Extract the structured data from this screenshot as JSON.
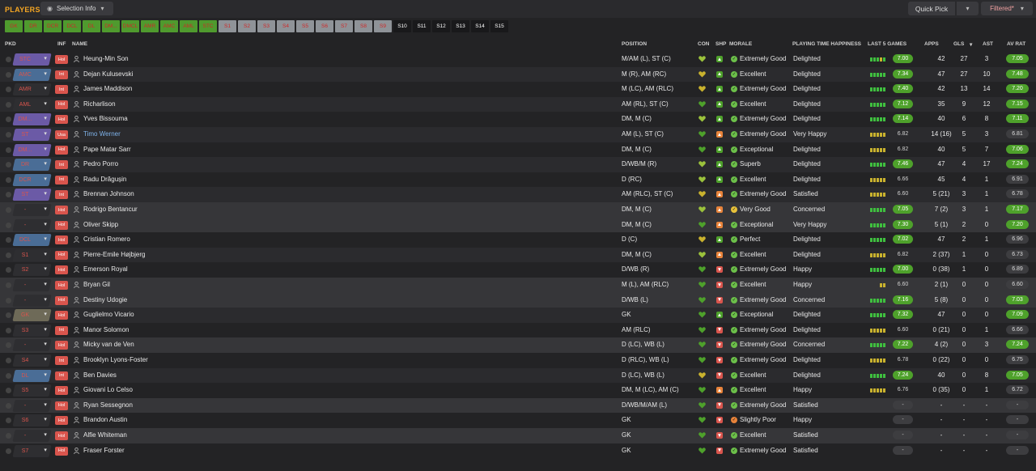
{
  "topbar": {
    "title": "PLAYERS",
    "selection_info": "Selection Info",
    "quick_pick": "Quick Pick",
    "filtered": "Filtered*"
  },
  "position_filters": [
    {
      "label": "GK",
      "state": "g"
    },
    {
      "label": "DR",
      "state": "g"
    },
    {
      "label": "DCR",
      "state": "g"
    },
    {
      "label": "DCL",
      "state": "g"
    },
    {
      "label": "DL",
      "state": "g"
    },
    {
      "label": "DM...",
      "state": "g"
    },
    {
      "label": "DMCL",
      "state": "g"
    },
    {
      "label": "AMR",
      "state": "g"
    },
    {
      "label": "AMC",
      "state": "g"
    },
    {
      "label": "AML",
      "state": "g"
    },
    {
      "label": "STC",
      "state": "g"
    },
    {
      "label": "S1",
      "state": "s"
    },
    {
      "label": "S2",
      "state": "s"
    },
    {
      "label": "S3",
      "state": "s"
    },
    {
      "label": "S4",
      "state": "s"
    },
    {
      "label": "S5",
      "state": "s"
    },
    {
      "label": "S6",
      "state": "s"
    },
    {
      "label": "S7",
      "state": "s"
    },
    {
      "label": "S8",
      "state": "s"
    },
    {
      "label": "S9",
      "state": "s"
    },
    {
      "label": "S10",
      "state": "d"
    },
    {
      "label": "S11",
      "state": "d"
    },
    {
      "label": "S12",
      "state": "d"
    },
    {
      "label": "S13",
      "state": "d"
    },
    {
      "label": "S14",
      "state": "d"
    },
    {
      "label": "S15",
      "state": "d"
    }
  ],
  "columns": {
    "pkd": "PKD",
    "inf": "INF",
    "name": "NAME",
    "position": "POSITION",
    "con": "CON",
    "shp": "SHP",
    "morale": "MORALE",
    "pth": "PLAYING TIME HAPPINESS",
    "last5": "LAST 5 GAMES",
    "apps": "APPS",
    "gls": "GLS",
    "ast": "AST",
    "avrat": "AV RAT"
  },
  "colors": {
    "green": "#4ea12b",
    "yellow_green": "#9bc23c",
    "yellow": "#c9b22e",
    "olive": "#b9a93c",
    "red": "#d9554d",
    "orange": "#e8833a",
    "purple": "#6b5aa6",
    "blue": "#4a6d96",
    "tan": "#6e6a58",
    "gray": "#8c8c8c"
  },
  "players": [
    {
      "pill": "STC",
      "pc": "#6b5aa6",
      "inf": "Hol",
      "name": "Heung-Min Son",
      "pos": "M/AM (L), ST (C)",
      "con": "#9bc23c",
      "shp": "up",
      "morale": "Extremely Good",
      "mc": "#6cc04a",
      "pth": "Delighted",
      "bars": [
        "g",
        "g",
        "g",
        "y",
        "g"
      ],
      "rating": "7.00",
      "rc": "#4ea12b",
      "apps": "42",
      "gls": "27",
      "ast": "3",
      "avr": "7.05",
      "avc": "#4ea12b"
    },
    {
      "pill": "AMC",
      "pc": "#4a6d96",
      "inf": "Int",
      "name": "Dejan Kulusevski",
      "pos": "M (R), AM (RC)",
      "con": "#c9b22e",
      "shp": "up",
      "morale": "Excellent",
      "mc": "#6cc04a",
      "pth": "Delighted",
      "bars": [
        "g",
        "g",
        "g",
        "g",
        "g"
      ],
      "rating": "7.34",
      "rc": "#4ea12b",
      "apps": "47",
      "gls": "27",
      "ast": "10",
      "avr": "7.48",
      "avc": "#4ea12b"
    },
    {
      "pill": "AMR",
      "pc": "#2e2e31",
      "inf": "Int",
      "name": "James Maddison",
      "pos": "M (LC), AM (RLC)",
      "con": "#c9b22e",
      "shp": "up",
      "morale": "Extremely Good",
      "mc": "#6cc04a",
      "pth": "Delighted",
      "bars": [
        "g",
        "g",
        "g",
        "g",
        "g"
      ],
      "rating": "7.40",
      "rc": "#4ea12b",
      "apps": "42",
      "gls": "13",
      "ast": "14",
      "avr": "7.20",
      "avc": "#4ea12b"
    },
    {
      "pill": "AML",
      "pc": "#2e2e31",
      "inf": "Hol",
      "name": "Richarlison",
      "pos": "AM (RL), ST (C)",
      "con": "#4ea12b",
      "shp": "up",
      "morale": "Excellent",
      "mc": "#6cc04a",
      "pth": "Delighted",
      "bars": [
        "g",
        "g",
        "g",
        "g",
        "g"
      ],
      "rating": "7.12",
      "rc": "#4ea12b",
      "apps": "35",
      "gls": "9",
      "ast": "12",
      "avr": "7.15",
      "avc": "#4ea12b"
    },
    {
      "pill": "DM...",
      "pc": "#6b5aa6",
      "inf": "Hol",
      "name": "Yves Bissouma",
      "pos": "DM, M (C)",
      "con": "#9bc23c",
      "shp": "up",
      "morale": "Extremely Good",
      "mc": "#6cc04a",
      "pth": "Delighted",
      "bars": [
        "g",
        "g",
        "g",
        "g",
        "g"
      ],
      "rating": "7.14",
      "rc": "#4ea12b",
      "apps": "40",
      "gls": "6",
      "ast": "8",
      "avr": "7.11",
      "avc": "#4ea12b"
    },
    {
      "pill": "ST",
      "pc": "#6b5aa6",
      "inf": "Usa",
      "name": "Timo Werner",
      "pos": "AM (L), ST (C)",
      "con": "#4ea12b",
      "shp": "upo",
      "morale": "Extremely Good",
      "mc": "#6cc04a",
      "pth": "Very Happy",
      "bars": [
        "y",
        "y",
        "y",
        "y",
        "y"
      ],
      "rating": "6.82",
      "rc": "",
      "apps": "14 (16)",
      "gls": "5",
      "ast": "3",
      "avr": "6.81",
      "avc": ""
    },
    {
      "pill": "DM...",
      "pc": "#6b5aa6",
      "inf": "Hol",
      "name": "Pape Matar Sarr",
      "pos": "DM, M (C)",
      "con": "#4ea12b",
      "shp": "up",
      "morale": "Exceptional",
      "mc": "#6cc04a",
      "pth": "Delighted",
      "bars": [
        "y",
        "y",
        "y",
        "y",
        "y"
      ],
      "rating": "6.82",
      "rc": "",
      "apps": "40",
      "gls": "5",
      "ast": "7",
      "avr": "7.06",
      "avc": "#4ea12b"
    },
    {
      "pill": "DR",
      "pc": "#4a6d96",
      "inf": "Int",
      "name": "Pedro Porro",
      "pos": "D/WB/M (R)",
      "con": "#9bc23c",
      "shp": "up",
      "morale": "Superb",
      "mc": "#6cc04a",
      "pth": "Delighted",
      "bars": [
        "g",
        "g",
        "g",
        "g",
        "g"
      ],
      "rating": "7.46",
      "rc": "#4ea12b",
      "apps": "47",
      "gls": "4",
      "ast": "17",
      "avr": "7.24",
      "avc": "#4ea12b"
    },
    {
      "pill": "DCR",
      "pc": "#4a6d96",
      "inf": "Int",
      "name": "Radu Drăgușin",
      "pos": "D (RC)",
      "con": "#9bc23c",
      "shp": "up",
      "morale": "Excellent",
      "mc": "#6cc04a",
      "pth": "Delighted",
      "bars": [
        "y",
        "y",
        "y",
        "y",
        "y"
      ],
      "rating": "6.66",
      "rc": "",
      "apps": "45",
      "gls": "4",
      "ast": "1",
      "avr": "6.91",
      "avc": ""
    },
    {
      "pill": "ST",
      "pc": "#6b5aa6",
      "inf": "Int",
      "name": "Brennan Johnson",
      "pos": "AM (RLC), ST (C)",
      "con": "#c9b22e",
      "shp": "upo",
      "morale": "Extremely Good",
      "mc": "#6cc04a",
      "pth": "Satisfied",
      "bars": [
        "y",
        "y",
        "y",
        "y",
        "y"
      ],
      "rating": "6.60",
      "rc": "",
      "apps": "5 (21)",
      "gls": "3",
      "ast": "1",
      "avr": "6.78",
      "avc": ""
    },
    {
      "pill": "-",
      "pc": "#2e2e31",
      "inf": "Hol",
      "name": "Rodrigo Bentancur",
      "pos": "DM, M (C)",
      "con": "#9bc23c",
      "shp": "upo",
      "morale": "Very Good",
      "mc": "#e8c23a",
      "pth": "Concerned",
      "bars": [
        "g",
        "g",
        "g",
        "g",
        "g"
      ],
      "rating": "7.05",
      "rc": "#4ea12b",
      "apps": "7 (2)",
      "gls": "3",
      "ast": "1",
      "avr": "7.17",
      "avc": "#4ea12b",
      "grey": true
    },
    {
      "pill": "-",
      "pc": "#2e2e31",
      "inf": "Hol",
      "name": "Oliver Skipp",
      "pos": "DM, M (C)",
      "con": "#4ea12b",
      "shp": "upo",
      "morale": "Exceptional",
      "mc": "#6cc04a",
      "pth": "Very Happy",
      "bars": [
        "g",
        "g",
        "g",
        "g",
        "g"
      ],
      "rating": "7.30",
      "rc": "#4ea12b",
      "apps": "5 (1)",
      "gls": "2",
      "ast": "0",
      "avr": "7.20",
      "avc": "#4ea12b",
      "grey": true
    },
    {
      "pill": "DCL",
      "pc": "#4a6d96",
      "inf": "Hol",
      "name": "Cristian Romero",
      "pos": "D (C)",
      "con": "#c9b22e",
      "shp": "upg",
      "morale": "Perfect",
      "mc": "#6cc04a",
      "pth": "Delighted",
      "bars": [
        "g",
        "g",
        "g",
        "g",
        "g"
      ],
      "rating": "7.02",
      "rc": "#4ea12b",
      "apps": "47",
      "gls": "2",
      "ast": "1",
      "avr": "6.96",
      "avc": ""
    },
    {
      "pill": "S1",
      "pc": "#2e2e31",
      "inf": "Hol",
      "name": "Pierre-Emile Højbjerg",
      "pos": "DM, M (C)",
      "con": "#9bc23c",
      "shp": "upo",
      "morale": "Excellent",
      "mc": "#6cc04a",
      "pth": "Delighted",
      "bars": [
        "y",
        "y",
        "y",
        "y",
        "y"
      ],
      "rating": "6.82",
      "rc": "",
      "apps": "2 (37)",
      "gls": "1",
      "ast": "0",
      "avr": "6.73",
      "avc": ""
    },
    {
      "pill": "S2",
      "pc": "#2e2e31",
      "inf": "Hol",
      "name": "Emerson Royal",
      "pos": "D/WB (R)",
      "con": "#4ea12b",
      "shp": "down",
      "morale": "Extremely Good",
      "mc": "#6cc04a",
      "pth": "Happy",
      "bars": [
        "g",
        "g",
        "g",
        "g",
        "g"
      ],
      "rating": "7.00",
      "rc": "#4ea12b",
      "apps": "0 (38)",
      "gls": "1",
      "ast": "0",
      "avr": "6.89",
      "avc": ""
    },
    {
      "pill": "-",
      "pc": "#2e2e31",
      "inf": "Hol",
      "name": "Bryan Gil",
      "pos": "M (L), AM (RLC)",
      "con": "#4ea12b",
      "shp": "down",
      "morale": "Excellent",
      "mc": "#6cc04a",
      "pth": "Happy",
      "bars": [
        "n",
        "n",
        "n",
        "y",
        "y"
      ],
      "rating": "6.60",
      "rc": "",
      "apps": "2 (1)",
      "gls": "0",
      "ast": "0",
      "avr": "6.60",
      "avc": "",
      "grey": true
    },
    {
      "pill": "-",
      "pc": "#2e2e31",
      "inf": "Hol",
      "name": "Destiny Udogie",
      "pos": "D/WB (L)",
      "con": "#4ea12b",
      "shp": "down",
      "morale": "Extremely Good",
      "mc": "#6cc04a",
      "pth": "Concerned",
      "bars": [
        "g",
        "g",
        "g",
        "g",
        "g"
      ],
      "rating": "7.16",
      "rc": "#4ea12b",
      "apps": "5 (8)",
      "gls": "0",
      "ast": "0",
      "avr": "7.03",
      "avc": "#4ea12b",
      "grey": true
    },
    {
      "pill": "GK",
      "pc": "#6e6a58",
      "inf": "Hol",
      "name": "Guglielmo Vicario",
      "pos": "GK",
      "con": "#4ea12b",
      "shp": "up",
      "morale": "Exceptional",
      "mc": "#6cc04a",
      "pth": "Delighted",
      "bars": [
        "g",
        "g",
        "g",
        "g",
        "g"
      ],
      "rating": "7.32",
      "rc": "#4ea12b",
      "apps": "47",
      "gls": "0",
      "ast": "0",
      "avr": "7.09",
      "avc": "#4ea12b"
    },
    {
      "pill": "S3",
      "pc": "#2e2e31",
      "inf": "Int",
      "name": "Manor Solomon",
      "pos": "AM (RLC)",
      "con": "#4ea12b",
      "shp": "down",
      "morale": "Extremely Good",
      "mc": "#6cc04a",
      "pth": "Delighted",
      "bars": [
        "y",
        "y",
        "y",
        "y",
        "y"
      ],
      "rating": "6.60",
      "rc": "",
      "apps": "0 (21)",
      "gls": "0",
      "ast": "1",
      "avr": "6.66",
      "avc": ""
    },
    {
      "pill": "-",
      "pc": "#2e2e31",
      "inf": "Hol",
      "name": "Micky van de Ven",
      "pos": "D (LC), WB (L)",
      "con": "#4ea12b",
      "shp": "down",
      "morale": "Extremely Good",
      "mc": "#6cc04a",
      "pth": "Concerned",
      "bars": [
        "g",
        "g",
        "g",
        "g",
        "g"
      ],
      "rating": "7.22",
      "rc": "#4ea12b",
      "apps": "4 (2)",
      "gls": "0",
      "ast": "3",
      "avr": "7.24",
      "avc": "#4ea12b",
      "grey": true
    },
    {
      "pill": "S4",
      "pc": "#2e2e31",
      "inf": "Int",
      "name": "Brooklyn Lyons-Foster",
      "pos": "D (RLC), WB (L)",
      "con": "#4ea12b",
      "shp": "down",
      "morale": "Extremely Good",
      "mc": "#6cc04a",
      "pth": "Delighted",
      "bars": [
        "y",
        "y",
        "y",
        "y",
        "y"
      ],
      "rating": "6.78",
      "rc": "",
      "apps": "0 (22)",
      "gls": "0",
      "ast": "0",
      "avr": "6.75",
      "avc": ""
    },
    {
      "pill": "DL",
      "pc": "#4a6d96",
      "inf": "Int",
      "name": "Ben Davies",
      "pos": "D (LC), WB (L)",
      "con": "#c9b22e",
      "shp": "down",
      "morale": "Excellent",
      "mc": "#6cc04a",
      "pth": "Delighted",
      "bars": [
        "g",
        "g",
        "g",
        "g",
        "g"
      ],
      "rating": "7.24",
      "rc": "#4ea12b",
      "apps": "40",
      "gls": "0",
      "ast": "8",
      "avr": "7.05",
      "avc": "#4ea12b"
    },
    {
      "pill": "S5",
      "pc": "#2e2e31",
      "inf": "Hol",
      "name": "Giovani Lo Celso",
      "pos": "DM, M (LC), AM (C)",
      "con": "#4ea12b",
      "shp": "upo",
      "morale": "Excellent",
      "mc": "#6cc04a",
      "pth": "Happy",
      "bars": [
        "y",
        "y",
        "y",
        "y",
        "y"
      ],
      "rating": "6.76",
      "rc": "",
      "apps": "0 (35)",
      "gls": "0",
      "ast": "1",
      "avr": "6.72",
      "avc": ""
    },
    {
      "pill": "-",
      "pc": "#2e2e31",
      "inf": "Hol",
      "name": "Ryan Sessegnon",
      "pos": "D/WB/M/AM (L)",
      "con": "#4ea12b",
      "shp": "down",
      "morale": "Extremely Good",
      "mc": "#6cc04a",
      "pth": "Satisfied",
      "bars": [],
      "rating": "-",
      "rc": "",
      "apps": "-",
      "gls": "-",
      "ast": "-",
      "avr": "-",
      "avc": "",
      "grey": true
    },
    {
      "pill": "S6",
      "pc": "#2e2e31",
      "inf": "Hol",
      "name": "Brandon Austin",
      "pos": "GK",
      "con": "#4ea12b",
      "shp": "down",
      "morale": "Slightly Poor",
      "mc": "#e8833a",
      "pth": "Happy",
      "bars": [],
      "rating": "-",
      "rc": "",
      "apps": "-",
      "gls": "-",
      "ast": "-",
      "avr": "-",
      "avc": ""
    },
    {
      "pill": "-",
      "pc": "#2e2e31",
      "inf": "Hol",
      "name": "Alfie Whiteman",
      "pos": "GK",
      "con": "#4ea12b",
      "shp": "down",
      "morale": "Excellent",
      "mc": "#6cc04a",
      "pth": "Satisfied",
      "bars": [],
      "rating": "-",
      "rc": "",
      "apps": "-",
      "gls": "-",
      "ast": "-",
      "avr": "-",
      "avc": "",
      "grey": true
    },
    {
      "pill": "S7",
      "pc": "#2e2e31",
      "inf": "Hol",
      "name": "Fraser Forster",
      "pos": "GK",
      "con": "#4ea12b",
      "shp": "down",
      "morale": "Extremely Good",
      "mc": "#6cc04a",
      "pth": "Satisfied",
      "bars": [],
      "rating": "-",
      "rc": "",
      "apps": "-",
      "gls": "-",
      "ast": "-",
      "avr": "-",
      "avc": ""
    }
  ]
}
